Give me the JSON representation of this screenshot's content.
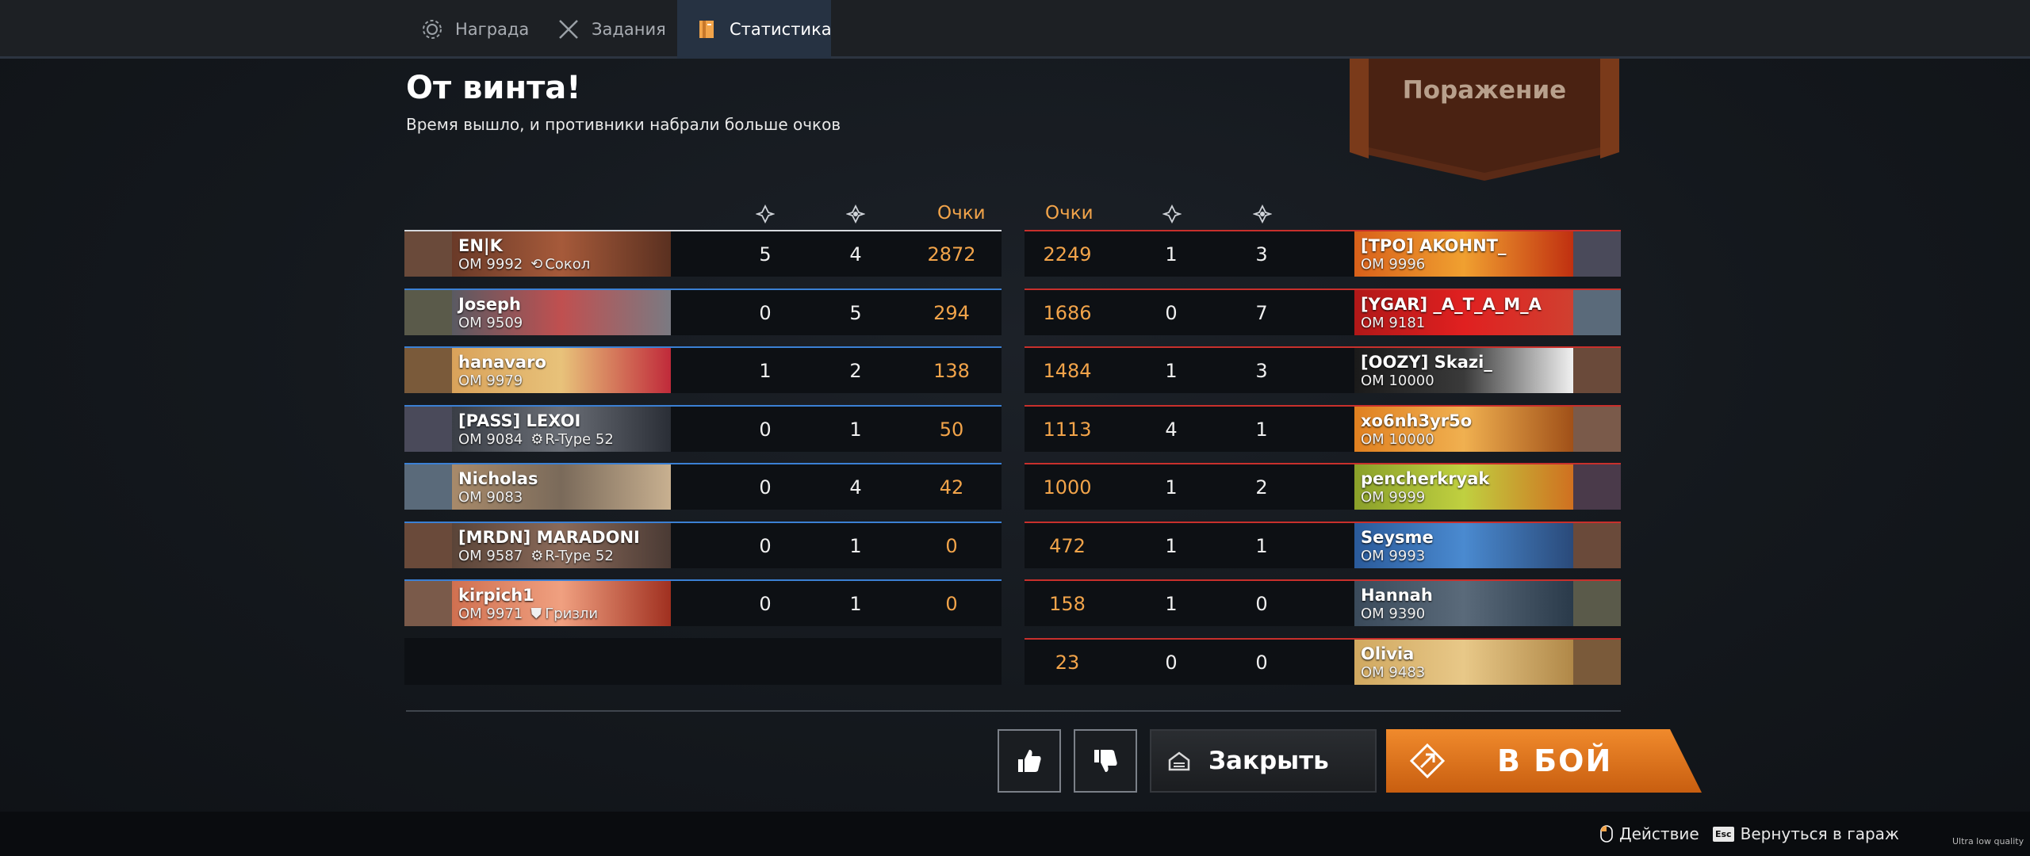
{
  "tabs": [
    {
      "label": "Награда",
      "icon": "reward-icon"
    },
    {
      "label": "Задания",
      "icon": "crossed-swords-icon"
    },
    {
      "label": "Статистика",
      "icon": "statistics-book-icon"
    }
  ],
  "header": {
    "title": "От винта!",
    "subtitle": "Время вышло, и противники набрали больше очков"
  },
  "result_banner": "Поражение",
  "columns": {
    "score_label": "Очки"
  },
  "colors": {
    "accent": "#f2a44a",
    "ally_line": "#3b80d4",
    "enemy_line": "#c8302c",
    "fight_button": "#e0741a"
  },
  "left_team": [
    {
      "name": "EN|K",
      "om": "ОМ 9992",
      "vehicle": "Сокол",
      "vehicle_icon": "helicopter-icon",
      "a": "5",
      "b": "4",
      "score": "2872"
    },
    {
      "name": "Joseph",
      "om": "ОМ 9509",
      "vehicle": "",
      "a": "0",
      "b": "5",
      "score": "294"
    },
    {
      "name": "hanavaro",
      "om": "ОМ 9979",
      "vehicle": "",
      "a": "1",
      "b": "2",
      "score": "138"
    },
    {
      "name": "[PASS] LEXOI",
      "om": "ОМ 9084",
      "vehicle": "R-Type 52",
      "vehicle_icon": "drone-icon",
      "a": "0",
      "b": "1",
      "score": "50"
    },
    {
      "name": "Nicholas",
      "om": "ОМ 9083",
      "vehicle": "",
      "a": "0",
      "b": "4",
      "score": "42"
    },
    {
      "name": "[MRDN] MARADONI",
      "om": "ОМ 9587",
      "vehicle": "R-Type 52",
      "vehicle_icon": "drone-icon",
      "a": "0",
      "b": "1",
      "score": "0"
    },
    {
      "name": "kirpich1",
      "om": "ОМ 9971",
      "vehicle": "Гризли",
      "vehicle_icon": "shield-icon",
      "a": "0",
      "b": "1",
      "score": "0"
    }
  ],
  "right_team": [
    {
      "name": "[TPO] AKOHNT_",
      "om": "ОМ 9996",
      "score": "2249",
      "a": "1",
      "b": "3"
    },
    {
      "name": "[YGAR] _A_T_A_M_A",
      "om": "ОМ 9181",
      "score": "1686",
      "a": "0",
      "b": "7"
    },
    {
      "name": "[OOZY] Skazi_",
      "om": "ОМ 10000",
      "score": "1484",
      "a": "1",
      "b": "3"
    },
    {
      "name": "xo6nh3yr5o",
      "om": "ОМ 10000",
      "score": "1113",
      "a": "4",
      "b": "1"
    },
    {
      "name": "pencherkryak",
      "om": "ОМ 9999",
      "score": "1000",
      "a": "1",
      "b": "2"
    },
    {
      "name": "Seysme",
      "om": "ОМ 9993",
      "score": "472",
      "a": "1",
      "b": "1"
    },
    {
      "name": "Hannah",
      "om": "ОМ 9390",
      "score": "158",
      "a": "1",
      "b": "0"
    },
    {
      "name": "Olivia",
      "om": "ОМ 9483",
      "score": "23",
      "a": "0",
      "b": "0"
    }
  ],
  "buttons": {
    "close": "Закрыть",
    "fight": "В БОЙ"
  },
  "hints": {
    "action": "Действие",
    "action_key": "mouse-left-icon",
    "back": "Вернуться в гараж",
    "back_key": "Esc"
  },
  "quality": "Ultra low quality"
}
